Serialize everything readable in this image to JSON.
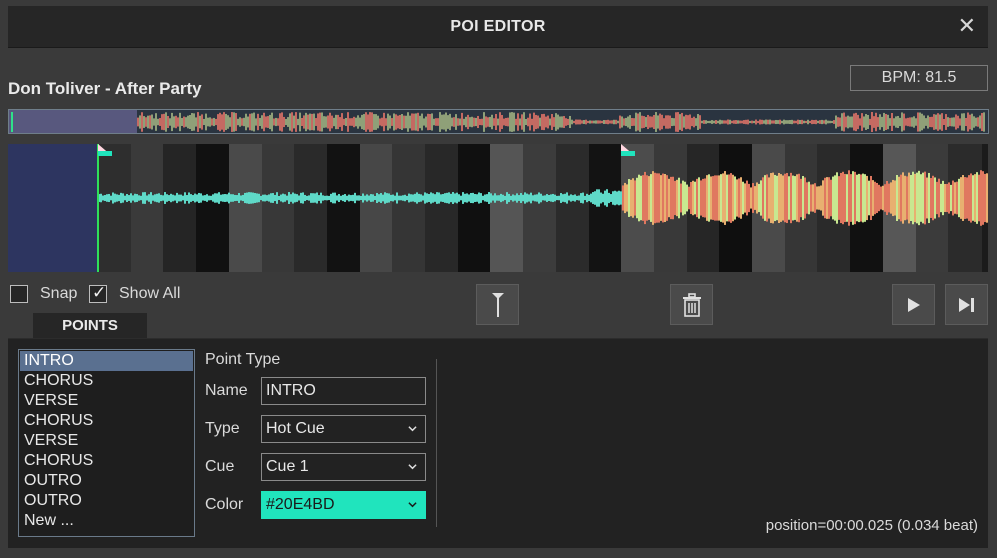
{
  "window": {
    "title": "POI EDITOR",
    "close_label": "✕"
  },
  "track": {
    "title": "Don Toliver - After Party",
    "bpm_label": "BPM: 81.5"
  },
  "waveform": {
    "colors": {
      "pre_region": "#2d3560",
      "cursor": "#2fe05a",
      "wave_quiet": "#5fd9c8",
      "wave_loud": "#e07860",
      "marker": "#20E4BD"
    }
  },
  "options": {
    "snap_label": "Snap",
    "snap_checked": false,
    "show_all_label": "Show All",
    "show_all_checked": true
  },
  "toolbar": {
    "marker_icon": "marker-pin-icon",
    "delete_icon": "trash-icon",
    "play_icon": "play-icon",
    "next_icon": "skip-next-icon"
  },
  "tabs": {
    "points": "POINTS"
  },
  "points": {
    "items": [
      "INTRO",
      "CHORUS",
      "VERSE",
      "CHORUS",
      "VERSE",
      "CHORUS",
      "OUTRO",
      "OUTRO",
      "New ..."
    ],
    "selected_index": 0
  },
  "form": {
    "section_label": "Point Type",
    "name_label": "Name",
    "name_value": "INTRO",
    "type_label": "Type",
    "type_value": "Hot Cue",
    "cue_label": "Cue",
    "cue_value": "Cue 1",
    "color_label": "Color",
    "color_value": "#20E4BD"
  },
  "status": {
    "position": "position=00:00.025 (0.034 beat)"
  }
}
